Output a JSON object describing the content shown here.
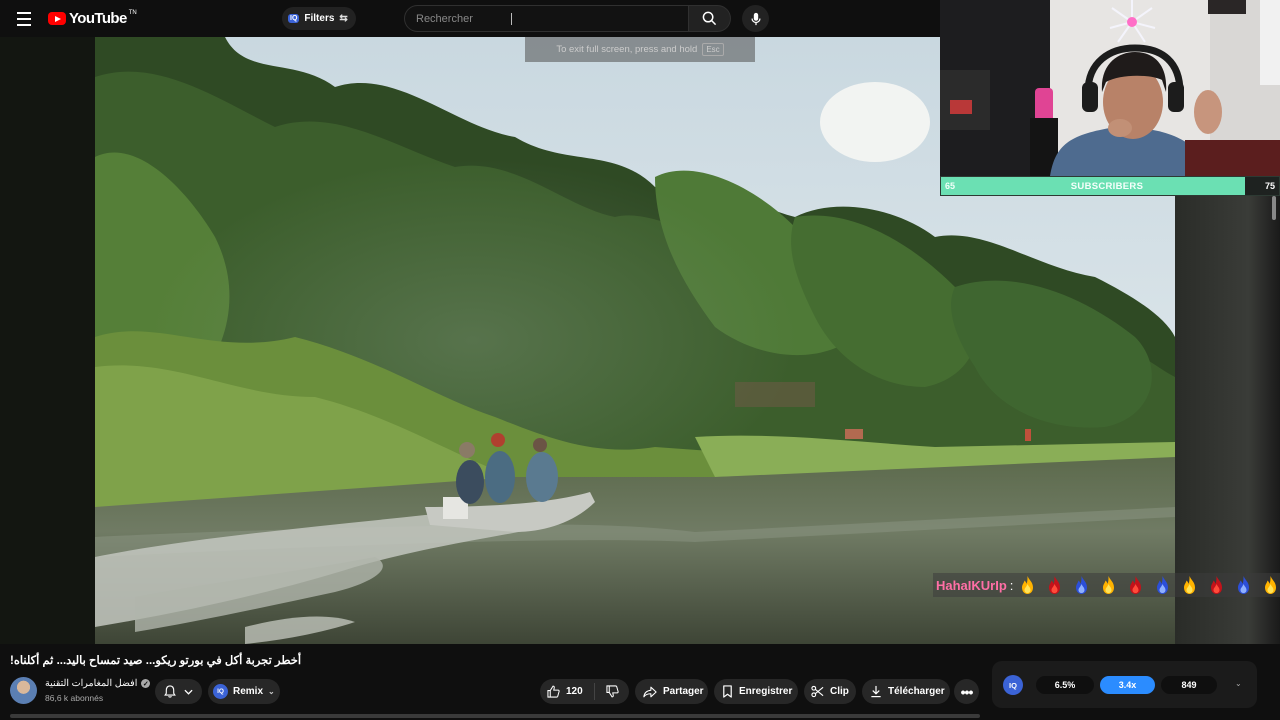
{
  "header": {
    "logo_text": "YouTube",
    "logo_superscript": "TN",
    "filters_label": "Filters",
    "filters_badge": "IQ",
    "search_placeholder": "Rechercher"
  },
  "fullscreen_hint": {
    "text": "To exit full screen, press and hold",
    "key": "Esc"
  },
  "stream_overlay": {
    "subscriber_goal": {
      "start": "65",
      "label": "SUBSCRIBERS",
      "end": "75",
      "progress_fraction": 0.9
    },
    "chat": {
      "username": "HahaIKUrIp",
      "separator": ":",
      "emotes": [
        "yellow-fire",
        "red-fire",
        "blue-fire",
        "yellow-fire",
        "red-fire",
        "blue-fire",
        "yellow-fire",
        "red-fire",
        "blue-fire",
        "yellow-fire"
      ]
    }
  },
  "video": {
    "title": "!أخطر تجربة أكل في بورتو ريكو... صيد تمساح باليد... ثم أكلناه",
    "channel_name": "افضل المغامرات التقنية",
    "subscribers": "86,6 k abonnés"
  },
  "actions": {
    "remix_label": "Remix",
    "remix_badge": "IQ",
    "like_count": "120",
    "share_label": "Partager",
    "save_label": "Enregistrer",
    "clip_label": "Clip",
    "download_label": "Télécharger"
  },
  "stats": {
    "badge": "IQ",
    "value1": "6.5%",
    "value2": "3.4x",
    "value3": "849"
  },
  "colors": {
    "accent": "#ff0000",
    "iq_blue": "#3b63d6",
    "goal_green": "#6be0b3",
    "stat_highlight": "#2b8cff",
    "chat_user": "#ff6fa6"
  }
}
